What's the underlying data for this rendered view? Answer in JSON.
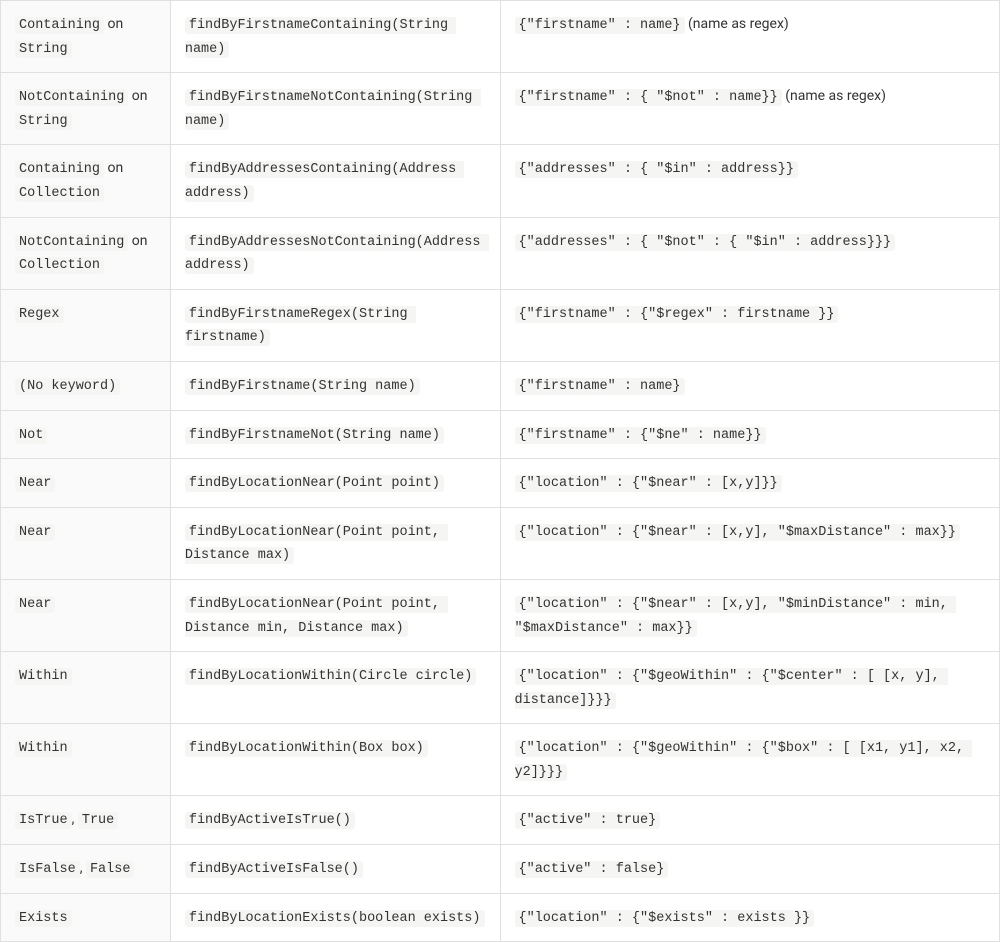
{
  "rows": [
    {
      "keyword_parts": [
        {
          "t": "code",
          "v": "Containing"
        },
        {
          "t": "text",
          "v": " on "
        },
        {
          "t": "code",
          "v": "String"
        }
      ],
      "sample": "findByFirstnameContaining(String name)",
      "snippet_parts": [
        {
          "t": "code",
          "v": "{\"firstname\" : name}"
        },
        {
          "t": "text",
          "v": " (name as regex)"
        }
      ]
    },
    {
      "keyword_parts": [
        {
          "t": "code",
          "v": "NotContaining"
        },
        {
          "t": "text",
          "v": " on "
        },
        {
          "t": "code",
          "v": "String"
        }
      ],
      "sample": "findByFirstnameNotContaining(String name)",
      "snippet_parts": [
        {
          "t": "code",
          "v": "{\"firstname\" : { \"$not\" : name}}"
        },
        {
          "t": "text",
          "v": " (name as regex)"
        }
      ]
    },
    {
      "keyword_parts": [
        {
          "t": "code",
          "v": "Containing"
        },
        {
          "t": "text",
          "v": " on "
        },
        {
          "t": "code",
          "v": "Collection"
        }
      ],
      "sample": "findByAddressesContaining(Address address)",
      "snippet_parts": [
        {
          "t": "code",
          "v": "{\"addresses\" : { \"$in\" : address}}"
        }
      ]
    },
    {
      "keyword_parts": [
        {
          "t": "code",
          "v": "NotContaining"
        },
        {
          "t": "text",
          "v": " on "
        },
        {
          "t": "code",
          "v": "Collection"
        }
      ],
      "sample": "findByAddressesNotContaining(Address address)",
      "snippet_parts": [
        {
          "t": "code",
          "v": "{\"addresses\" : { \"$not\" : { \"$in\" : address}}}"
        }
      ]
    },
    {
      "keyword_parts": [
        {
          "t": "code",
          "v": "Regex"
        }
      ],
      "sample": "findByFirstnameRegex(String firstname)",
      "snippet_parts": [
        {
          "t": "code",
          "v": "{\"firstname\" : {\"$regex\" : firstname }}"
        }
      ]
    },
    {
      "keyword_parts": [
        {
          "t": "code",
          "v": "(No keyword)"
        }
      ],
      "sample": "findByFirstname(String name)",
      "snippet_parts": [
        {
          "t": "code",
          "v": "{\"firstname\" : name}"
        }
      ]
    },
    {
      "keyword_parts": [
        {
          "t": "code",
          "v": "Not"
        }
      ],
      "sample": "findByFirstnameNot(String name)",
      "snippet_parts": [
        {
          "t": "code",
          "v": "{\"firstname\" : {\"$ne\" : name}}"
        }
      ]
    },
    {
      "keyword_parts": [
        {
          "t": "code",
          "v": "Near"
        }
      ],
      "sample": "findByLocationNear(Point point)",
      "snippet_parts": [
        {
          "t": "code",
          "v": "{\"location\" : {\"$near\" : [x,y]}}"
        }
      ]
    },
    {
      "keyword_parts": [
        {
          "t": "code",
          "v": "Near"
        }
      ],
      "sample": "findByLocationNear(Point point, Distance max)",
      "snippet_parts": [
        {
          "t": "code",
          "v": "{\"location\" : {\"$near\" : [x,y], \"$maxDistance\" : max}}"
        }
      ]
    },
    {
      "keyword_parts": [
        {
          "t": "code",
          "v": "Near"
        }
      ],
      "sample": "findByLocationNear(Point point, Distance min, Distance max)",
      "snippet_parts": [
        {
          "t": "code",
          "v": "{\"location\" : {\"$near\" : [x,y], \"$minDistance\" : min, \"$maxDistance\" : max}}"
        }
      ]
    },
    {
      "keyword_parts": [
        {
          "t": "code",
          "v": "Within"
        }
      ],
      "sample": "findByLocationWithin(Circle circle)",
      "snippet_parts": [
        {
          "t": "code",
          "v": "{\"location\" : {\"$geoWithin\" : {\"$center\" : [ [x, y], distance]}}}"
        }
      ]
    },
    {
      "keyword_parts": [
        {
          "t": "code",
          "v": "Within"
        }
      ],
      "sample": "findByLocationWithin(Box box)",
      "snippet_parts": [
        {
          "t": "code",
          "v": "{\"location\" : {\"$geoWithin\" : {\"$box\" : [ [x1, y1], x2, y2]}}}"
        }
      ]
    },
    {
      "keyword_parts": [
        {
          "t": "code",
          "v": "IsTrue"
        },
        {
          "t": "text",
          "v": ", "
        },
        {
          "t": "code",
          "v": "True"
        }
      ],
      "sample": "findByActiveIsTrue()",
      "snippet_parts": [
        {
          "t": "code",
          "v": "{\"active\" : true}"
        }
      ]
    },
    {
      "keyword_parts": [
        {
          "t": "code",
          "v": "IsFalse"
        },
        {
          "t": "text",
          "v": ", "
        },
        {
          "t": "code",
          "v": "False"
        }
      ],
      "sample": "findByActiveIsFalse()",
      "snippet_parts": [
        {
          "t": "code",
          "v": "{\"active\" : false}"
        }
      ]
    },
    {
      "keyword_parts": [
        {
          "t": "code",
          "v": "Exists"
        }
      ],
      "sample": "findByLocationExists(boolean exists)",
      "snippet_parts": [
        {
          "t": "code",
          "v": "{\"location\" : {\"$exists\" : exists }}"
        }
      ]
    }
  ]
}
